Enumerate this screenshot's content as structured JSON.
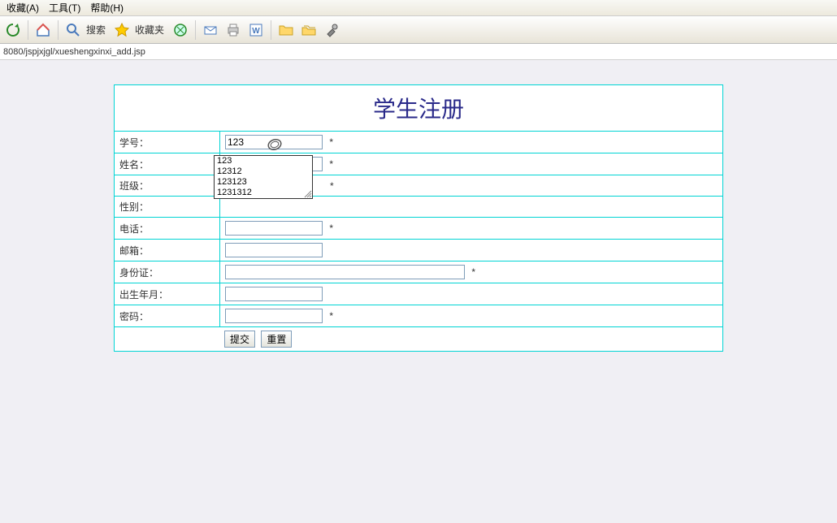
{
  "menubar": {
    "favorites": "收藏(A)",
    "tools": "工具(T)",
    "help": "帮助(H)"
  },
  "toolbar": {
    "search_label": "搜索",
    "favorites_label": "收藏夹"
  },
  "address": "8080/jspjxjgl/xueshengxinxi_add.jsp",
  "form": {
    "title": "学生注册",
    "fields": {
      "student_id": {
        "label": "学号：",
        "value": "123",
        "required": "*"
      },
      "name": {
        "label": "姓名：",
        "value": "123",
        "required": "*"
      },
      "class": {
        "label": "班级：",
        "value": "",
        "required": "*"
      },
      "gender": {
        "label": "性别：",
        "value": ""
      },
      "phone": {
        "label": "电话：",
        "value": "",
        "required": "*"
      },
      "email": {
        "label": "邮箱：",
        "value": ""
      },
      "id_card": {
        "label": "身份证：",
        "value": "",
        "required": "*"
      },
      "birth": {
        "label": "出生年月：",
        "value": ""
      },
      "password": {
        "label": "密码：",
        "value": "",
        "required": "*"
      }
    },
    "buttons": {
      "submit": "提交",
      "reset": "重置"
    }
  },
  "autocomplete": {
    "items": [
      "123",
      "12312",
      "123123",
      "1231312"
    ]
  }
}
